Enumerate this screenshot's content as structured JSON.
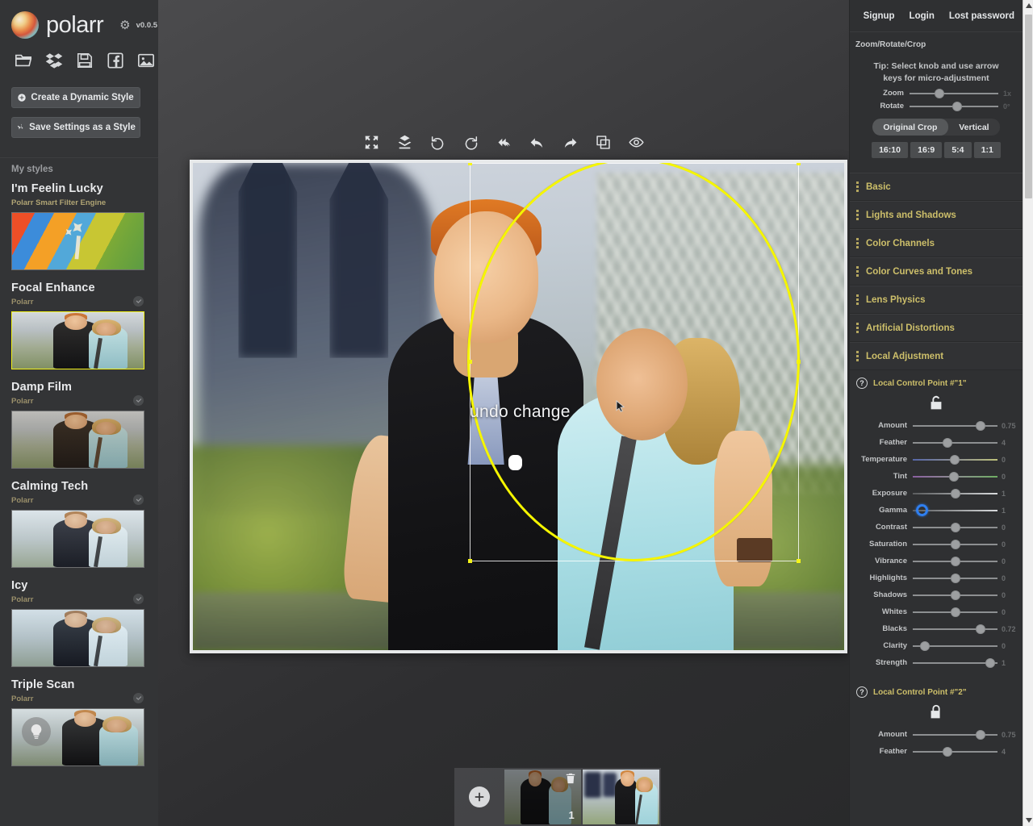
{
  "app": {
    "brand": "polarr",
    "version": "v0.0.5",
    "bug_icon": "bug-icon"
  },
  "sidebar": {
    "file_icons": [
      {
        "name": "open-folder-icon",
        "label": "Open"
      },
      {
        "name": "dropbox-icon",
        "label": "Dropbox"
      },
      {
        "name": "save-floppy-icon",
        "label": "Save"
      },
      {
        "name": "facebook-icon",
        "label": "Facebook"
      },
      {
        "name": "image-icon",
        "label": "Image"
      }
    ],
    "create_dynamic_style": "Create a Dynamic Style",
    "save_settings_as_style": "Save Settings as a Style",
    "my_styles_header": "My styles",
    "styles": [
      {
        "title": "I'm Feelin Lucky",
        "author": "Polarr Smart Filter Engine",
        "kind": "magic",
        "selected": false,
        "has_check": false
      },
      {
        "title": "Focal Enhance",
        "author": "Polarr",
        "kind": "photo",
        "selected": true,
        "has_check": true
      },
      {
        "title": "Damp Film",
        "author": "Polarr",
        "kind": "photo",
        "selected": false,
        "has_check": true
      },
      {
        "title": "Calming Tech",
        "author": "Polarr",
        "kind": "photo",
        "selected": false,
        "has_check": true
      },
      {
        "title": "Icy",
        "author": "Polarr",
        "kind": "photo",
        "selected": false,
        "has_check": true
      },
      {
        "title": "Triple Scan",
        "author": "Polarr",
        "kind": "photo-bulb",
        "selected": false,
        "has_check": true
      }
    ]
  },
  "center": {
    "toolbar": [
      {
        "name": "fit-screen-icon",
        "label": "Fit to screen"
      },
      {
        "name": "compare-layers-icon",
        "label": "Compare"
      },
      {
        "name": "rotate-left-icon",
        "label": "Rotate left"
      },
      {
        "name": "rotate-right-icon",
        "label": "Rotate right"
      },
      {
        "name": "reset-all-icon",
        "label": "Reset all"
      },
      {
        "name": "undo-icon",
        "label": "Undo"
      },
      {
        "name": "redo-icon",
        "label": "Redo"
      },
      {
        "name": "duplicate-icon",
        "label": "Duplicate"
      },
      {
        "name": "preview-eye-icon",
        "label": "Preview"
      }
    ],
    "overlay_label": "undo change",
    "filmstrip": {
      "add_label": "+",
      "thumbs": [
        {
          "name": "filmstrip-thumb-1",
          "badge": "1",
          "selected": false,
          "hovered": true,
          "delete_icon": "trash-icon"
        },
        {
          "name": "filmstrip-thumb-2",
          "badge": "",
          "selected": true,
          "hovered": false,
          "delete_icon": ""
        }
      ]
    }
  },
  "right": {
    "auth": [
      "Signup",
      "Login",
      "Lost password"
    ],
    "crop_section_title": "Zoom/Rotate/Crop",
    "tip": "Tip: Select knob and use arrow keys for micro-adjustment",
    "zoom_rotate": [
      {
        "label": "Zoom",
        "value": "1x",
        "pos": 30
      },
      {
        "label": "Rotate",
        "value": "0°",
        "pos": 50
      }
    ],
    "crop_modes": [
      {
        "label": "Original Crop",
        "active": true
      },
      {
        "label": "Vertical",
        "active": false
      }
    ],
    "ratios": [
      "16:10",
      "16:9",
      "5:4",
      "1:1"
    ],
    "sections": [
      "Basic",
      "Lights and Shadows",
      "Color Channels",
      "Color Curves and Tones",
      "Lens Physics",
      "Artificial Distortions",
      "Local Adjustment"
    ],
    "control_points": [
      {
        "title": "Local Control Point #\"1\"",
        "help_icon": "question-icon",
        "lock_icon": "unlock-icon",
        "locked": false,
        "sliders": [
          {
            "label": "Amount",
            "value": "0.75",
            "pos": 76,
            "track": "plain",
            "active": false
          },
          {
            "label": "Feather",
            "value": "4",
            "pos": 37,
            "track": "plain",
            "active": false
          },
          {
            "label": "Temperature",
            "value": "0",
            "pos": 46,
            "track": "temp",
            "active": false
          },
          {
            "label": "Tint",
            "value": "0",
            "pos": 45,
            "track": "tint",
            "active": false
          },
          {
            "label": "Exposure",
            "value": "1",
            "pos": 47,
            "track": "expo",
            "active": false
          },
          {
            "label": "Gamma",
            "value": "1",
            "pos": 7,
            "track": "gamma",
            "active": true
          },
          {
            "label": "Contrast",
            "value": "0",
            "pos": 47,
            "track": "plain",
            "active": false
          },
          {
            "label": "Saturation",
            "value": "0",
            "pos": 47,
            "track": "plain",
            "active": false
          },
          {
            "label": "Vibrance",
            "value": "0",
            "pos": 47,
            "track": "plain",
            "active": false
          },
          {
            "label": "Highlights",
            "value": "0",
            "pos": 47,
            "track": "plain",
            "active": false
          },
          {
            "label": "Shadows",
            "value": "0",
            "pos": 47,
            "track": "plain",
            "active": false
          },
          {
            "label": "Whites",
            "value": "0",
            "pos": 47,
            "track": "plain",
            "active": false
          },
          {
            "label": "Blacks",
            "value": "0.72",
            "pos": 76,
            "track": "plain",
            "active": false
          },
          {
            "label": "Clarity",
            "value": "0",
            "pos": 12,
            "track": "plain",
            "active": false
          },
          {
            "label": "Strength",
            "value": "1",
            "pos": 88,
            "track": "plain",
            "active": false
          }
        ]
      },
      {
        "title": "Local Control Point #\"2\"",
        "help_icon": "question-icon",
        "lock_icon": "lock-icon",
        "locked": true,
        "sliders": [
          {
            "label": "Amount",
            "value": "0.75",
            "pos": 76,
            "track": "plain",
            "active": false
          },
          {
            "label": "Feather",
            "value": "4",
            "pos": 37,
            "track": "plain",
            "active": false
          }
        ]
      }
    ],
    "scrollbar": {
      "up_icon": "chevron-up-icon",
      "down_icon": "chevron-down-icon"
    }
  }
}
